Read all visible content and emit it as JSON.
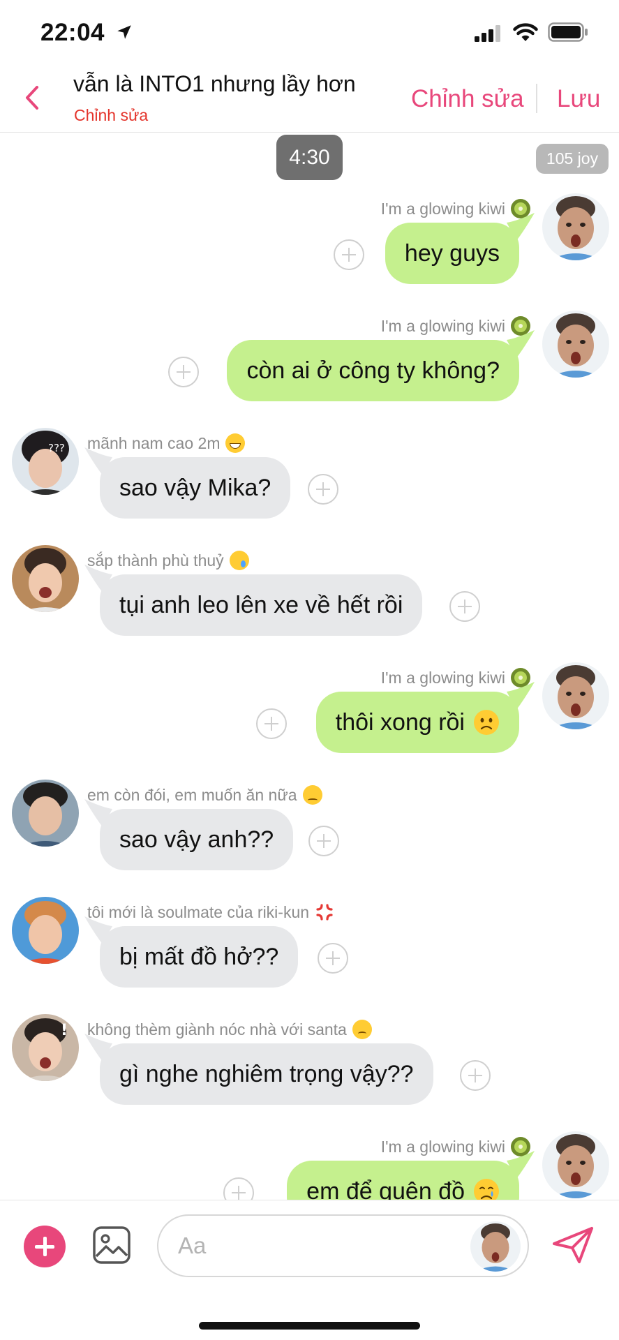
{
  "status_bar": {
    "time": "22:04",
    "icons": [
      "location-arrow-icon",
      "cellular-signal-icon",
      "wifi-icon",
      "battery-icon"
    ]
  },
  "header": {
    "title": "vẫn là INTO1 nhưng lầy hơn",
    "subtitle": "Chỉnh sửa",
    "edit_label": "Chỉnh sửa",
    "save_label": "Lưu",
    "accent_color": "#e8477b",
    "subtitle_color": "#e4342b"
  },
  "timeline": {
    "time_label": "4:30",
    "joy_label": "105 joy"
  },
  "messages": [
    {
      "side": "me",
      "sender": "I'm a glowing kiwi",
      "sender_emoji": "kiwi-emoji",
      "text": "hey guys"
    },
    {
      "side": "me",
      "sender": "I'm a glowing kiwi",
      "sender_emoji": "kiwi-emoji",
      "text": "còn ai ở công ty không?"
    },
    {
      "side": "other",
      "sender": "mãnh nam cao 2m",
      "sender_emoji": "grinning-emoji",
      "text": "sao vậy Mika?"
    },
    {
      "side": "other",
      "sender": "sắp thành phù thuỷ",
      "sender_emoji": "crying-emoji",
      "text": "tụi anh leo lên xe về hết rồi"
    },
    {
      "side": "me",
      "sender": "I'm a glowing kiwi",
      "sender_emoji": "kiwi-emoji",
      "text": "thôi xong rồi",
      "inline_emoji": "worried-emoji"
    },
    {
      "side": "other",
      "sender": "em còn đói, em muốn ăn nữa",
      "sender_emoji": "disappointed-emoji",
      "text": "sao vậy anh??"
    },
    {
      "side": "other",
      "sender": "tôi mới là soulmate của riki-kun",
      "sender_emoji": "anger-symbol-emoji",
      "text": "bị mất đồ hở??"
    },
    {
      "side": "other",
      "sender": "không thèm giành nóc nhà với santa",
      "sender_emoji": "frowning-emoji",
      "text": "gì nghe nghiêm trọng vậy??"
    },
    {
      "side": "me",
      "sender": "I'm a glowing kiwi",
      "sender_emoji": "kiwi-emoji",
      "text": "em để quên đồ",
      "inline_emoji": "crying-emoji"
    }
  ],
  "composer": {
    "placeholder": "Aa",
    "plus_icon": "plus-icon",
    "image_icon": "image-icon",
    "send_icon": "send-icon"
  },
  "colors": {
    "my_bubble": "#c5f08e",
    "other_bubble": "#e7e8ea",
    "time_pill": "#6f6f6f",
    "joy_pill": "#b8b8b8"
  }
}
